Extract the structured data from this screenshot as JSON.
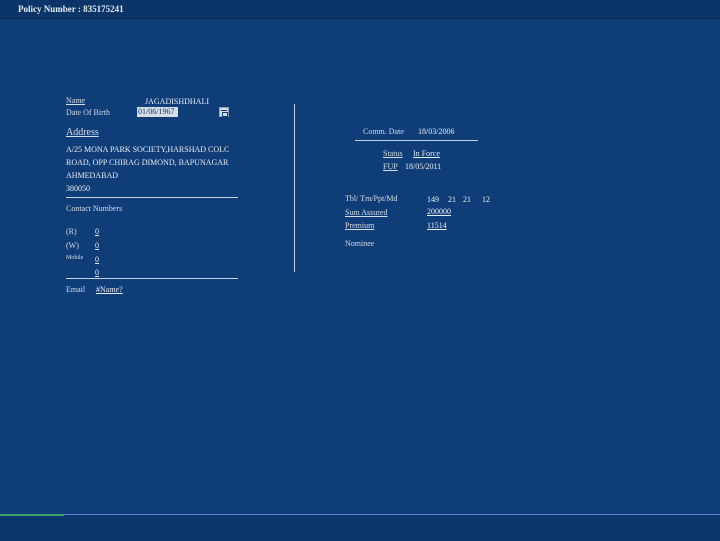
{
  "header": {
    "title": "Policy Number : 835175241"
  },
  "personal": {
    "name_label": "Name",
    "name_value": "JAGADISHDHALI",
    "dob_label": "Date Of Birth",
    "dob_value": "01/06/1967",
    "address_label": "Address",
    "address_lines": [
      "A/25 MONA PARK SOCIETY,HARSHAD COLC",
      "ROAD, OPP CHIRAG DIMOND, BAPUNAGAR",
      "AHMEDABAD",
      "380050"
    ],
    "contact_label": "Contact Numbers",
    "contacts": [
      {
        "label": "(R)",
        "value": "0"
      },
      {
        "label": "(W)",
        "value": "0"
      },
      {
        "label": "Mobile",
        "value": "0"
      },
      {
        "label": "",
        "value": "0"
      }
    ],
    "email_label": "Email",
    "email_value": "#Name?"
  },
  "policy": {
    "comm_date_label": "Comm. Date",
    "comm_date_value": "18/03/2006",
    "status_label": "Status",
    "status_value": "In Force",
    "fup_label": "FUP",
    "fup_value": "18/05/2011",
    "tbl_label": "Tbl/ Tm/Ppt/Md",
    "tbl_values": [
      "149",
      "21",
      "21",
      "12"
    ],
    "sum_label": "Sum Assured",
    "sum_value": "200000",
    "premium_label": "Premium",
    "premium_value": "11514",
    "nominee_label": "Nominee"
  }
}
